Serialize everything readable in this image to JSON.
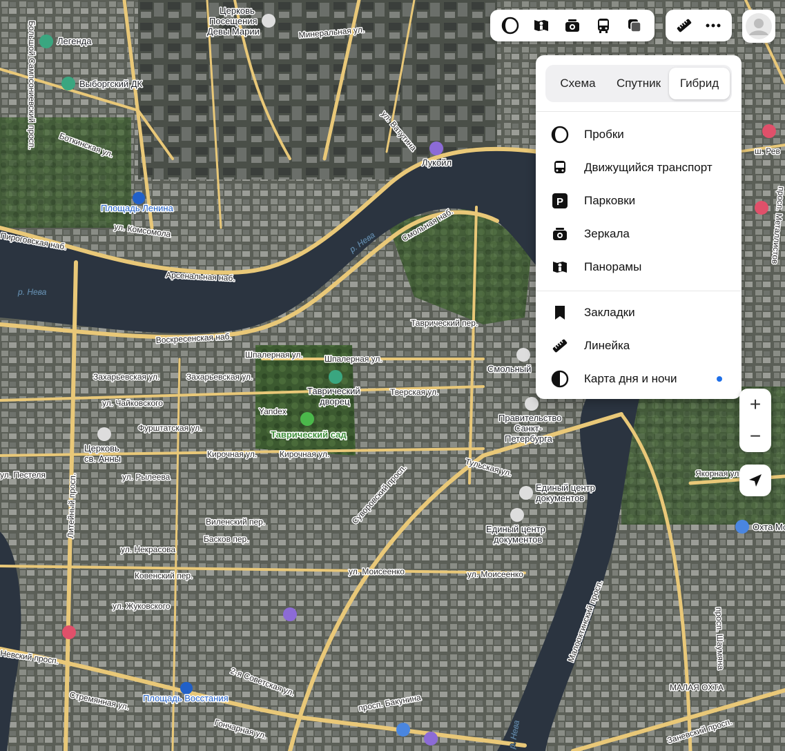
{
  "toolbar": {
    "traffic_icon": "traffic-icon",
    "panorama_icon": "panorama-icon",
    "mirrors_icon": "camera-icon",
    "transport_icon": "bus-icon",
    "layers_icon": "layers-icon",
    "ruler_icon": "ruler-icon",
    "more_icon": "more-icon"
  },
  "layers_panel": {
    "map_types": [
      "Схема",
      "Спутник",
      "Гибрид"
    ],
    "active_map_type": "Гибрид",
    "items": [
      {
        "label": "Пробки",
        "icon": "traffic-icon"
      },
      {
        "label": "Движущийся транспорт",
        "icon": "bus-icon"
      },
      {
        "label": "Парковки",
        "icon": "parking-icon"
      },
      {
        "label": "Зеркала",
        "icon": "camera-icon"
      },
      {
        "label": "Панорамы",
        "icon": "panorama-icon"
      }
    ],
    "tools": [
      {
        "label": "Закладки",
        "icon": "bookmark-icon"
      },
      {
        "label": "Линейка",
        "icon": "ruler-icon"
      },
      {
        "label": "Карта дня и ночи",
        "icon": "day-night-icon",
        "indicator": true
      }
    ]
  },
  "zoom": {
    "plus": "+",
    "minus": "−"
  },
  "map_labels": {
    "church_top": "Церковь",
    "church_top2": "Посещения",
    "church_top3": "Девы Марии",
    "legend": "Легенда",
    "vyborg_dk": "Выборгский ДК",
    "botkin": "Боткинская ул.",
    "lenin_sq": "Площадь Ленина",
    "komsomol": "ул. Комсомола",
    "pirogov": "Пироговская наб.",
    "arsenal": "Арсенальная наб.",
    "neva_left": "р. Нева",
    "neva_center": "р. Нева",
    "neva_bottom": "р. Нева",
    "lukoil": "Лукойл",
    "smolnaya": "Смольная наб.",
    "mineral": "Минеральная ул.",
    "vatutina": "ул. Ватутина",
    "voskres": "Воскресенская наб.",
    "shpalernaya": "Шпалерная ул.",
    "shpalernaya2": "Шпалерная ул.",
    "tavrich_per": "Таврический пер.",
    "tavrich_palace": "Таврический",
    "tavrich_palace2": "дворец",
    "tavrich_garden": "Таврический сад",
    "tverskaya": "Тверская ул.",
    "smolny": "Смольный",
    "gov1": "Правительство",
    "gov2": "Санкт-",
    "gov3": "Петербурга",
    "zakharev": "Захарьевская ул.",
    "zakharev2": "Захарьевская ул.",
    "chaikovsk": "ул. Чайковского",
    "furshtat": "Фурштатская ул.",
    "church_anna": "Церковь",
    "church_anna2": "св. Анны",
    "kirochnaya": "Кирочная ул.",
    "kirochnaya2": "Кирочная ул.",
    "ryleeva": "ул. Рылеева",
    "pestelya": "ул. Пестеля",
    "liteyny": "Литейный просп.",
    "tulskaya": "Тульская ул.",
    "suvorov": "Суворовский просп.",
    "edin1": "Единый центр",
    "edin1b": "документов",
    "edin2": "Единый центр",
    "edin2b": "документов",
    "nekrasova": "ул. Некрасова",
    "kovensky": "Ковенский пер.",
    "moiseenko": "ул. Моисеенко",
    "moiseenko2": "ул. Моисеенко",
    "zhukovsk": "ул. Жуковского",
    "vosstaniya": "Площадь Восстания",
    "nevsky": "Невский просп.",
    "sovet2": "2-я Советская ул.",
    "bakunina": "просп. Бакунина",
    "goncharn": "Гончарная ул.",
    "yakornaya": "Якорная ул.",
    "okhta": "Охта Молл",
    "malaya_okhta": "МАЛАЯ ОХТА",
    "zanevsky": "Заневский просп.",
    "shaumyana": "просп. Шаумяна",
    "rev": "ш. Рев",
    "metallistov": "просп. Металлистов",
    "malookhtinsky": "Малоохтинский просп.",
    "stremyannaya": "Стремянная ул.",
    "vilensky": "Виленский пер.",
    "baskov": "Басков пер.",
    "yandex": "Yandex",
    "bolsampsonievsky": "Большой Сампсониевский просп."
  }
}
